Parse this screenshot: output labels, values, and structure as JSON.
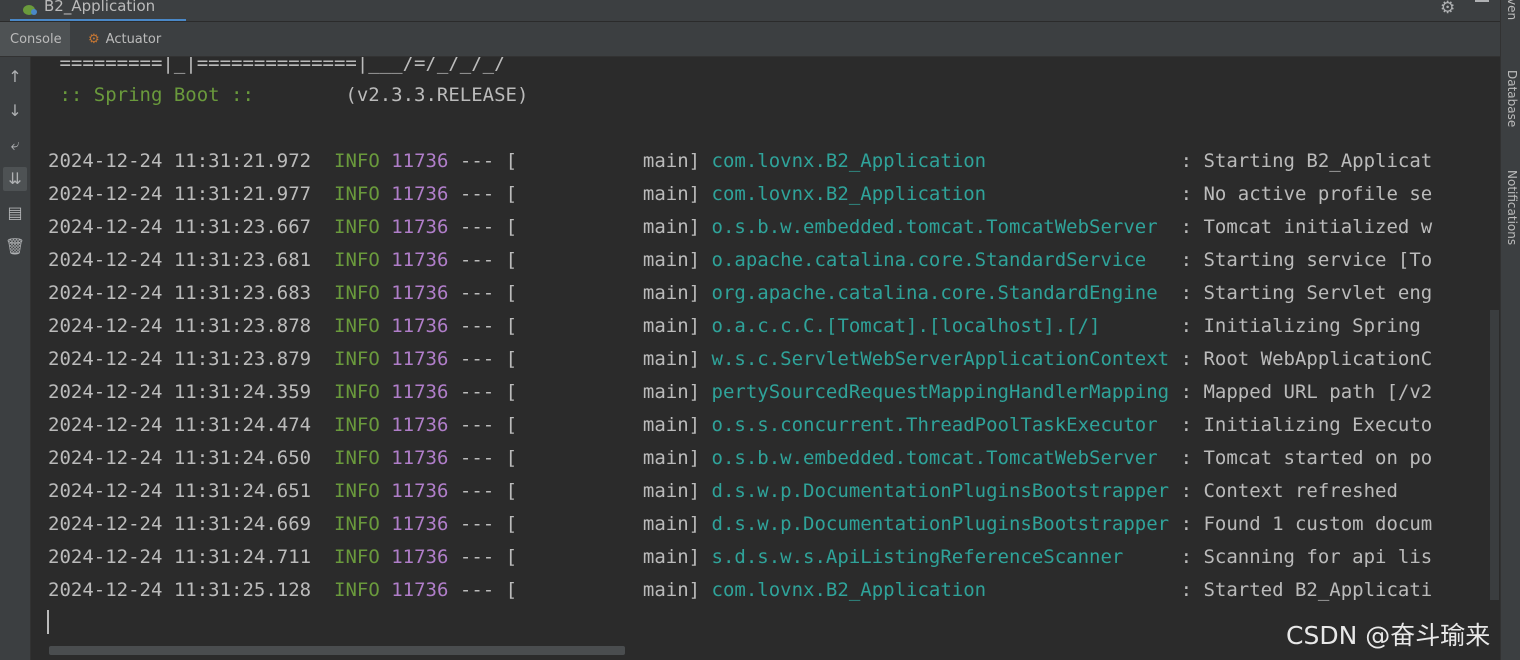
{
  "run_tab": {
    "title": "B2_Application"
  },
  "tabs": [
    {
      "label": "Console"
    },
    {
      "label": "Actuator"
    }
  ],
  "right_panels": [
    {
      "label": "ven"
    },
    {
      "label": "Database"
    },
    {
      "label": "Notifications"
    }
  ],
  "banner": {
    "line1": " =========|_|==============|___/=/_/_/_/",
    "spring_label": " :: Spring Boot :: ",
    "version": "       (v2.3.3.RELEASE)"
  },
  "log_lines": [
    {
      "timestamp": "2024-12-24 11:31:21.972",
      "level": "INFO",
      "pid": "11736",
      "thread": "--- [           main]",
      "logger": "com.lovnx.B2_Application                ",
      "message": ": Starting B2_Applicat"
    },
    {
      "timestamp": "2024-12-24 11:31:21.977",
      "level": "INFO",
      "pid": "11736",
      "thread": "--- [           main]",
      "logger": "com.lovnx.B2_Application                ",
      "message": ": No active profile se"
    },
    {
      "timestamp": "2024-12-24 11:31:23.667",
      "level": "INFO",
      "pid": "11736",
      "thread": "--- [           main]",
      "logger": "o.s.b.w.embedded.tomcat.TomcatWebServer ",
      "message": ": Tomcat initialized w"
    },
    {
      "timestamp": "2024-12-24 11:31:23.681",
      "level": "INFO",
      "pid": "11736",
      "thread": "--- [           main]",
      "logger": "o.apache.catalina.core.StandardService  ",
      "message": ": Starting service [To"
    },
    {
      "timestamp": "2024-12-24 11:31:23.683",
      "level": "INFO",
      "pid": "11736",
      "thread": "--- [           main]",
      "logger": "org.apache.catalina.core.StandardEngine ",
      "message": ": Starting Servlet eng"
    },
    {
      "timestamp": "2024-12-24 11:31:23.878",
      "level": "INFO",
      "pid": "11736",
      "thread": "--- [           main]",
      "logger": "o.a.c.c.C.[Tomcat].[localhost].[/]      ",
      "message": ": Initializing Spring "
    },
    {
      "timestamp": "2024-12-24 11:31:23.879",
      "level": "INFO",
      "pid": "11736",
      "thread": "--- [           main]",
      "logger": "w.s.c.ServletWebServerApplicationContext",
      "message": ": Root WebApplicationC"
    },
    {
      "timestamp": "2024-12-24 11:31:24.359",
      "level": "INFO",
      "pid": "11736",
      "thread": "--- [           main]",
      "logger": "pertySourcedRequestMappingHandlerMapping",
      "message": ": Mapped URL path [/v2"
    },
    {
      "timestamp": "2024-12-24 11:31:24.474",
      "level": "INFO",
      "pid": "11736",
      "thread": "--- [           main]",
      "logger": "o.s.s.concurrent.ThreadPoolTaskExecutor ",
      "message": ": Initializing Executo"
    },
    {
      "timestamp": "2024-12-24 11:31:24.650",
      "level": "INFO",
      "pid": "11736",
      "thread": "--- [           main]",
      "logger": "o.s.b.w.embedded.tomcat.TomcatWebServer ",
      "message": ": Tomcat started on po"
    },
    {
      "timestamp": "2024-12-24 11:31:24.651",
      "level": "INFO",
      "pid": "11736",
      "thread": "--- [           main]",
      "logger": "d.s.w.p.DocumentationPluginsBootstrapper",
      "message": ": Context refreshed"
    },
    {
      "timestamp": "2024-12-24 11:31:24.669",
      "level": "INFO",
      "pid": "11736",
      "thread": "--- [           main]",
      "logger": "d.s.w.p.DocumentationPluginsBootstrapper",
      "message": ": Found 1 custom docum"
    },
    {
      "timestamp": "2024-12-24 11:31:24.711",
      "level": "INFO",
      "pid": "11736",
      "thread": "--- [           main]",
      "logger": "s.d.s.w.s.ApiListingReferenceScanner    ",
      "message": ": Scanning for api lis"
    },
    {
      "timestamp": "2024-12-24 11:31:25.128",
      "level": "INFO",
      "pid": "11736",
      "thread": "--- [           main]",
      "logger": "com.lovnx.B2_Application                ",
      "message": ": Started B2_Applicati"
    }
  ],
  "watermark": "CSDN @奋斗瑜来",
  "colors": {
    "background": "#2b2b2b",
    "level_info": "#6a9a3c",
    "pid": "#b07ec9",
    "logger": "#2fa39a",
    "tab_underline": "#4a88c7"
  }
}
